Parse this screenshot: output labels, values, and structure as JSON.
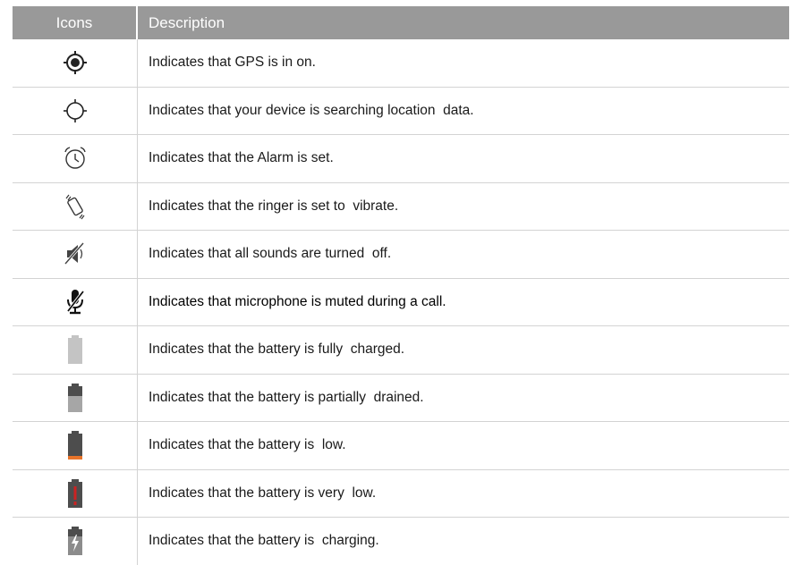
{
  "table": {
    "headers": {
      "icons": "Icons",
      "description": "Description"
    },
    "rows": [
      {
        "icon": "gps-on-icon",
        "description": "Indicates that GPS is in on."
      },
      {
        "icon": "gps-searching-icon",
        "description": "Indicates that your device is searching location  data."
      },
      {
        "icon": "alarm-icon",
        "description": "Indicates that the Alarm is set."
      },
      {
        "icon": "vibrate-icon",
        "description": "Indicates that the ringer is set to  vibrate."
      },
      {
        "icon": "sound-off-icon",
        "description": "Indicates that all sounds are turned  off."
      },
      {
        "icon": "mic-muted-icon",
        "description": "Indicates that microphone is muted during a call."
      },
      {
        "icon": "battery-full-icon",
        "description": "Indicates that the battery is fully  charged."
      },
      {
        "icon": "battery-partial-icon",
        "description": "Indicates that the battery is partially  drained."
      },
      {
        "icon": "battery-low-icon",
        "description": "Indicates that the battery is  low."
      },
      {
        "icon": "battery-very-low-icon",
        "description": "Indicates that the battery is very  low."
      },
      {
        "icon": "battery-charging-icon",
        "description": "Indicates that the battery is  charging."
      }
    ]
  },
  "colors": {
    "header_bg": "#999999",
    "battery_fill": "#c4c4c4",
    "battery_dark": "#4d4d4d",
    "battery_low_bar": "#e8742a",
    "battery_alert": "#cc2222"
  }
}
